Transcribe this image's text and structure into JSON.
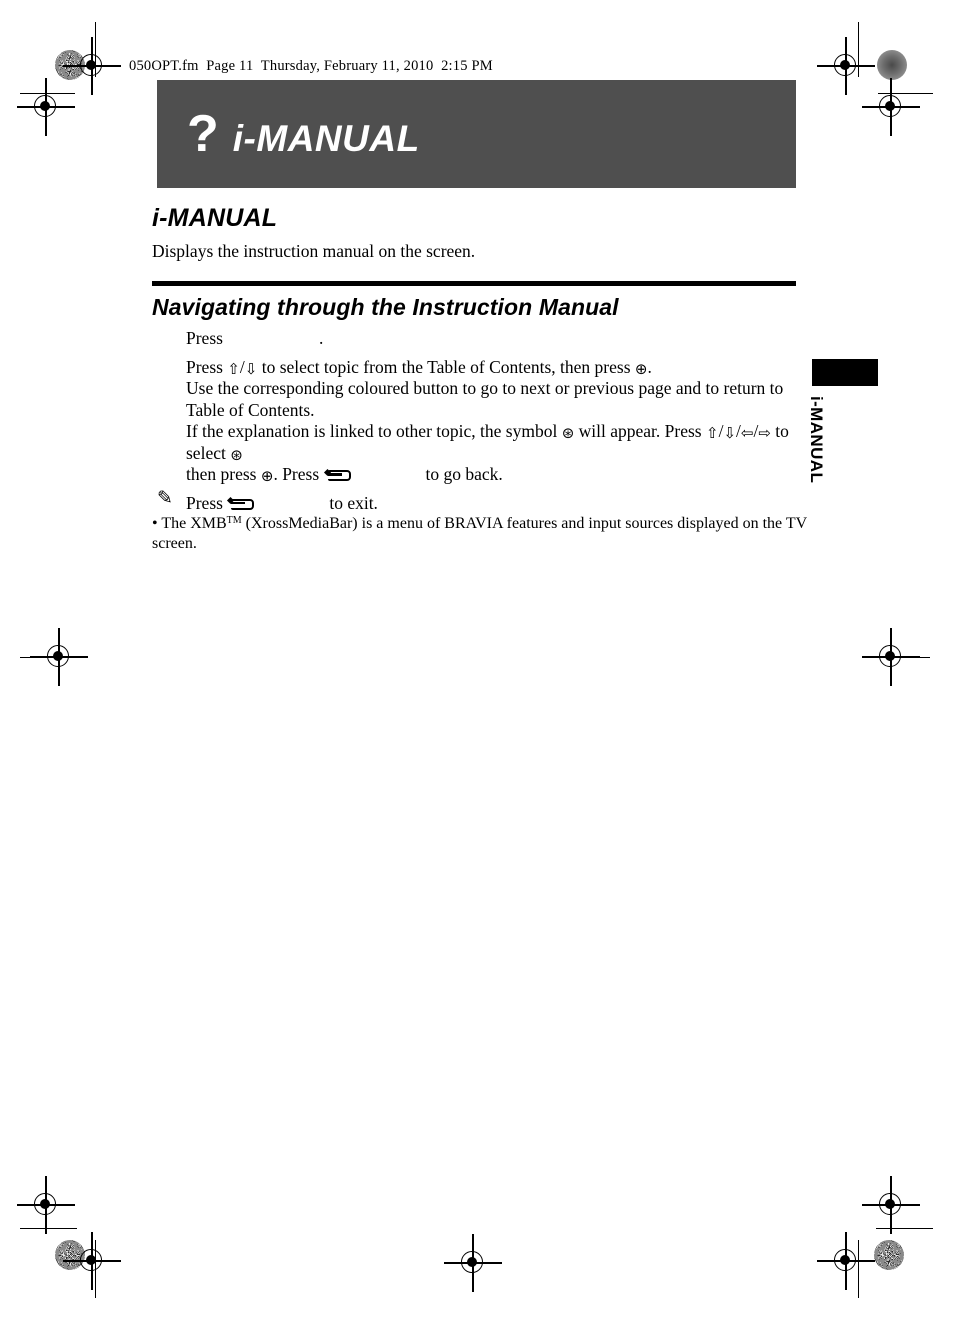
{
  "page": {
    "slug": "050OPT.fm  Page 11  Thursday, February 11, 2010  2:15 PM",
    "banner_color": "#4f4f4f",
    "text_color": "#000000"
  },
  "banner": {
    "question_mark": "?",
    "title": "i-MANUAL"
  },
  "section": {
    "heading": "i-MANUAL",
    "lead": "Displays the instruction manual on the screen."
  },
  "subsection": {
    "heading": "Navigating through the Instruction Manual"
  },
  "steps": {
    "step1_press": "Press",
    "step1_period": ".",
    "step2": "Press",
    "step2_arrows_up": "⇧",
    "step2_slash": "/",
    "step2_arrows_down": "⇩",
    "step2_mid": "to select topic from the Table of Contents, then press",
    "step2_enter": "⊕",
    "step2_period": ".",
    "step3": "Use the corresponding coloured button to go to next or previous page and to return to Table of Contents.",
    "step4_a": "If the explanation is linked to other topic, the symbol",
    "step4_linksym": "⊛",
    "step4_b": "will appear. Press",
    "step4_arrow_up": "⇧",
    "step4_arrow_down": "⇩",
    "step4_arrow_left": "⇦",
    "step4_arrow_right": "⇨",
    "step4_c": "to select",
    "step4_linksym2": "⊛",
    "step5_a": "then press",
    "step5_enter": "⊕",
    "step5_b": ". Press",
    "step5_c": "to go back.",
    "step6_a": "Press",
    "step6_b": "to exit."
  },
  "note": {
    "icon": "✎",
    "bullet": "•",
    "text_before_tm": " The XMB",
    "trademark": "TM",
    "text_after_tm": " (XrossMediaBar) is a menu of BRAVIA features and input sources displayed on the TV screen."
  },
  "side_tab": {
    "label": "i-MANUAL"
  }
}
